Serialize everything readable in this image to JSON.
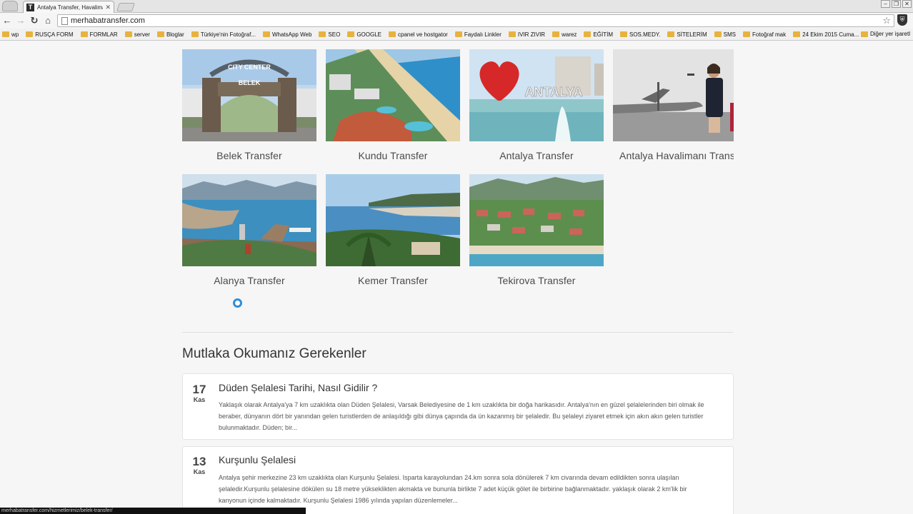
{
  "browser": {
    "tab_title": "Antalya Transfer, Havalimanı",
    "tab_favicon": "T",
    "url": "merhabatransfer.com",
    "bookmarks": [
      "wp",
      "RUSÇA FORM",
      "FORMLAR",
      "server",
      "Bloglar",
      "Türkiye'nin Fotoğraf...",
      "WhatsApp Web",
      "SEO",
      "GOOGLE",
      "cpanel ve hostgator",
      "Faydalı Linkler",
      "IVIR ZIVIR",
      "warez",
      "EĞİTİM",
      "SOS.MEDY.",
      "SİTELERİM",
      "SMS",
      "Fotoğraf mak",
      "24 Ekim 2015 Cuma..."
    ],
    "other_bookmarks": "Diğer yer işaretl",
    "status_url": "merhabatransfer.com/hizmetlerimiz/belek-transfer/"
  },
  "services": [
    {
      "label": "Belek Transfer",
      "icon": "city-center-arch-photo"
    },
    {
      "label": "Kundu Transfer",
      "icon": "beach-resort-photo"
    },
    {
      "label": "Antalya Transfer",
      "icon": "antalya-sign-photo"
    },
    {
      "label": "Antalya Havalimanı Transfer",
      "icon": "airport-photo"
    },
    {
      "label": "Alanya Transfer",
      "icon": "alanya-harbor-photo"
    },
    {
      "label": "Kemer Transfer",
      "icon": "kemer-coast-photo"
    },
    {
      "label": "Tekirova Transfer",
      "icon": "tekirova-resort-photo"
    }
  ],
  "section": {
    "title": "Mutlaka Okumanız Gerekenler"
  },
  "posts": [
    {
      "day": "17",
      "month": "Kas",
      "title": "Düden Şelalesi Tarihi, Nasıl Gidilir ?",
      "lines": [
        "Yaklaşık olarak Antalya'ya 7 km uzaklıkta olan Düden Şelalesi, Varsak Belediyesine de 1 km uzaklıkta bir doğa harikasıdır. Antalya'nın en güzel şelalelerinden biri olmak ile",
        "beraber, dünyanın dört bir yanından  gelen turistlerden de anlaşıldığı gibi dünya çapında da ün kazanmış bir şelaledir. Bu şelaleyi ziyaret etmek için akın akın gelen turistler",
        "bulunmaktadır. Düden; bir..."
      ]
    },
    {
      "day": "13",
      "month": "Kas",
      "title": "Kurşunlu Şelalesi",
      "lines": [
        "Antalya şehir merkezine 23 km uzaklıkta olan Kurşunlu Şelalesi. Isparta karayolundan  24.km sonra sola dönülerek 7 km civarında devam edildikten sonra ulaşılan",
        "şelaledir.Kurşunlu şelalesine dökülen su 18 metre yükseklikten akmakta ve bununla birlikte 7 adet küçük gölet ile birbirine bağlanmaktadır. yaklaşık olarak 2 km'lik bir",
        "kanyonun içinde kalmaktadır. Kurşunlu Şelalesi 1986 yılında yapılan düzenlemeler..."
      ]
    }
  ],
  "photo_text": {
    "arch_sign": "CITY CENTER",
    "arch_sub": "BELEK",
    "antalya_sign": "ANTALYA"
  }
}
